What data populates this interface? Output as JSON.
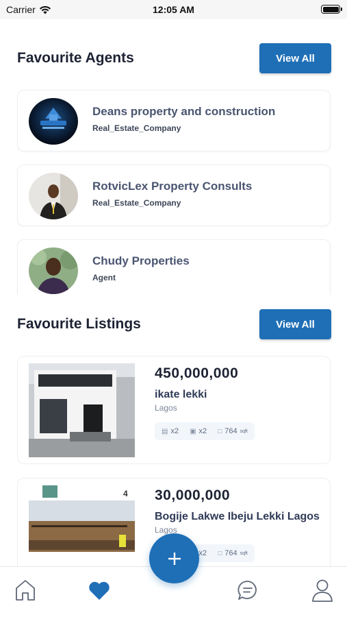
{
  "status_bar": {
    "carrier": "Carrier",
    "time": "12:05 AM"
  },
  "agents_section": {
    "title": "Favourite Agents",
    "view_all_label": "View All"
  },
  "agents": [
    {
      "name": "Deans property and construction",
      "type": "Real_Estate_Company"
    },
    {
      "name": "RotvicLex Property Consults",
      "type": "Real_Estate_Company"
    },
    {
      "name": "Chudy Properties",
      "type": "Agent"
    }
  ],
  "listings_section": {
    "title": "Favourite Listings",
    "view_all_label": "View All"
  },
  "listings": [
    {
      "price": "450,000,000",
      "title": "ikate lekki",
      "location": "Lagos",
      "beds": "x2",
      "baths": "x2",
      "area": "764",
      "area_unit": "sqft"
    },
    {
      "price": "30,000,000",
      "title": "Bogije Lakwe Ibeju Lekki Lagos",
      "location": "Lagos",
      "beds": "x2",
      "baths": "x2",
      "area": "764",
      "area_unit": "sqft",
      "sign_number": "4"
    }
  ],
  "colors": {
    "accent": "#1f6fb7",
    "heading": "#1d2233",
    "muted": "#7b8598"
  },
  "bottom_nav": {
    "items": [
      "home-icon",
      "heart-icon",
      "chat-icon",
      "profile-icon"
    ],
    "active": "heart-icon",
    "fab_icon": "plus-icon"
  }
}
